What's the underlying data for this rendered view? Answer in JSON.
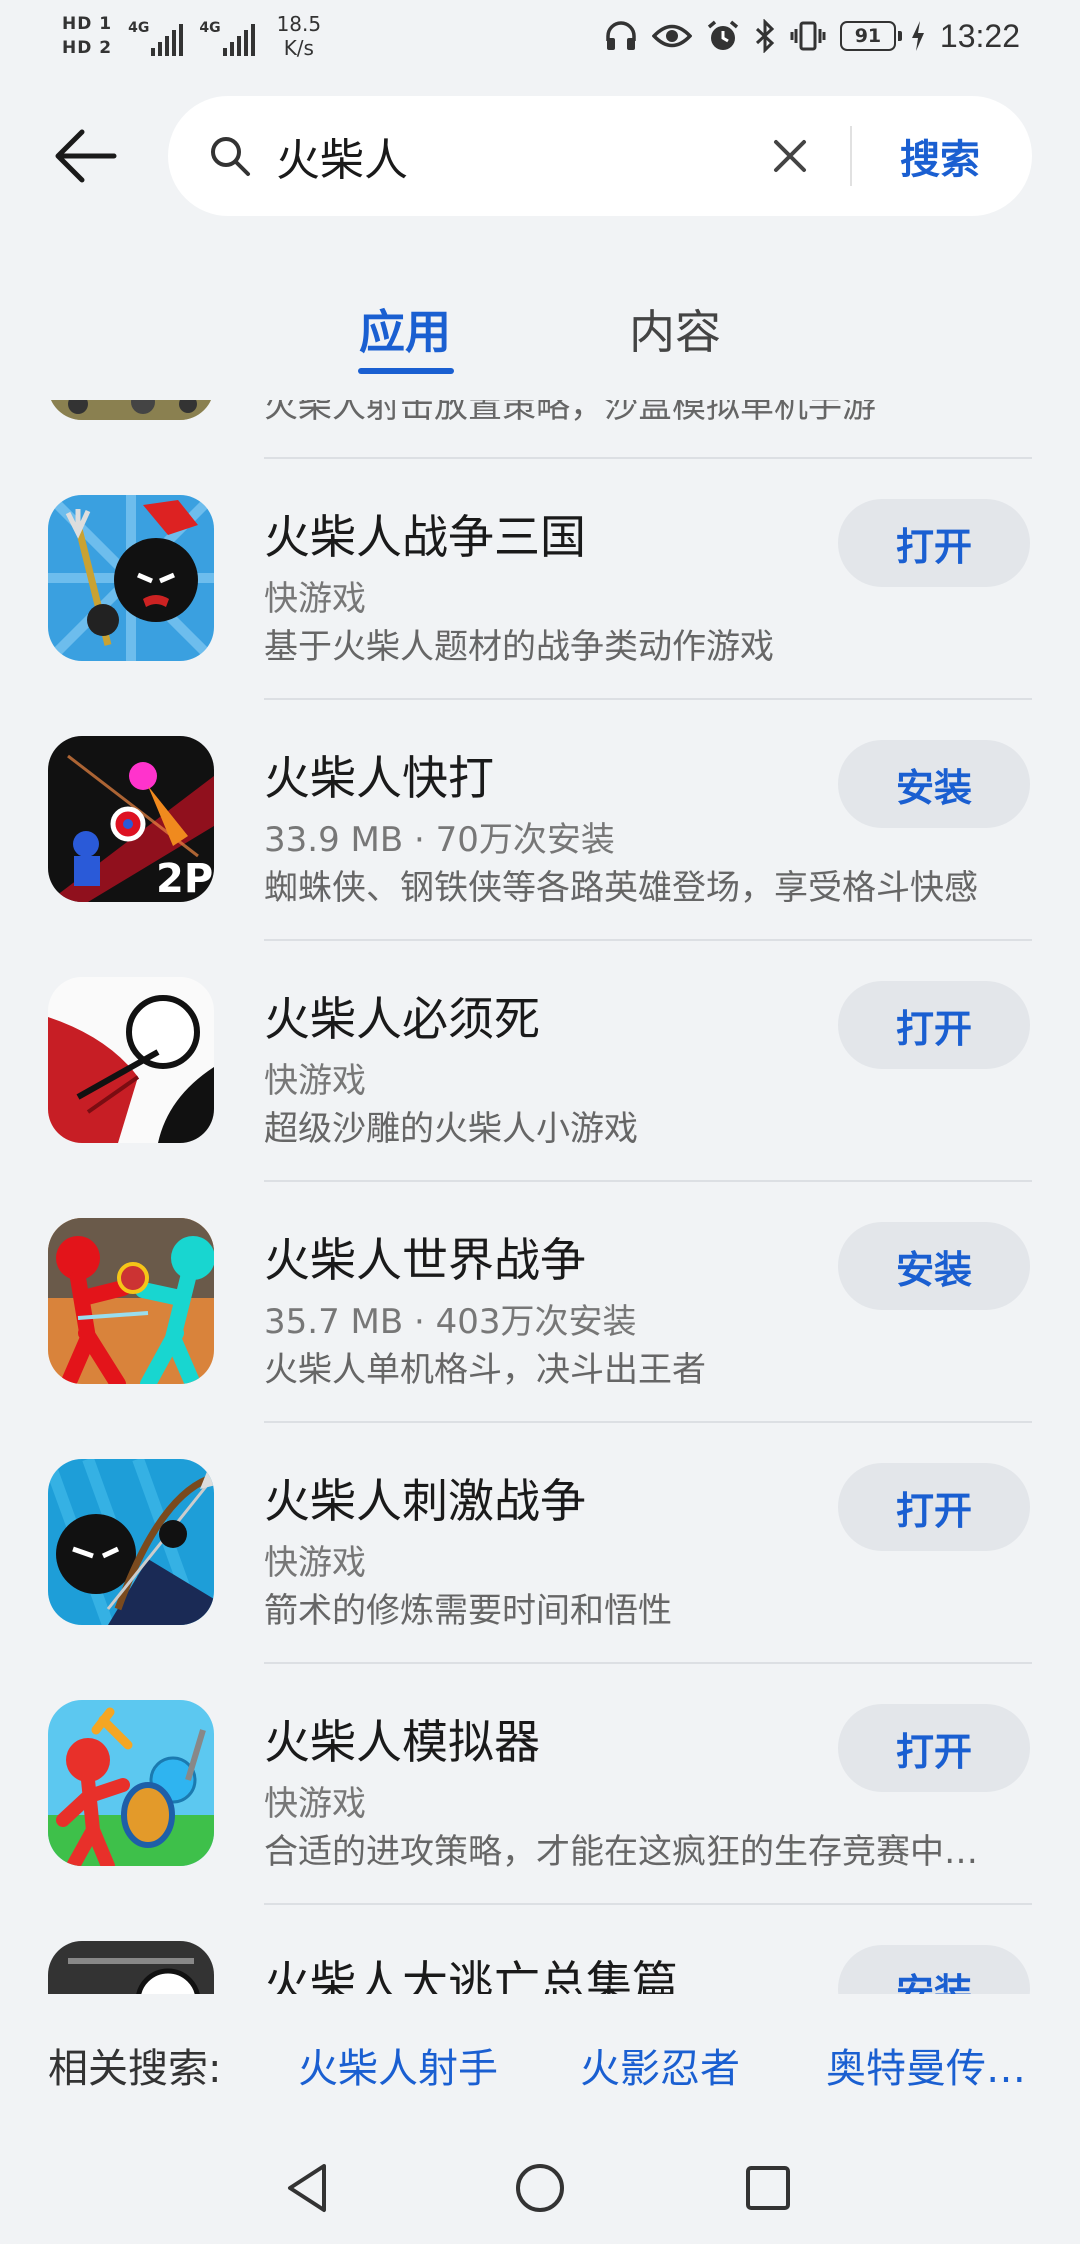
{
  "status_bar": {
    "sim1": "HD 1",
    "sim2": "HD 2",
    "net1": "4G",
    "net2": "4G",
    "speed_value": "18.5",
    "speed_unit": "K/s",
    "battery": "91",
    "time": "13:22"
  },
  "search": {
    "query": "火柴人",
    "button_label": "搜索"
  },
  "tabs": [
    {
      "label": "应用",
      "active": true
    },
    {
      "label": "内容",
      "active": false
    }
  ],
  "apps": [
    {
      "name": "",
      "meta": "",
      "desc": "火柴人射击放置策略，沙盒模拟单机手游",
      "action": ""
    },
    {
      "name": "火柴人战争三国",
      "meta": "快游戏",
      "desc": "基于火柴人题材的战争类动作游戏",
      "action": "打开"
    },
    {
      "name": "火柴人快打",
      "meta": "33.9 MB · 70万次安装",
      "desc": "蜘蛛侠、钢铁侠等各路英雄登场，享受格斗快感",
      "action": "安装"
    },
    {
      "name": "火柴人必须死",
      "meta": "快游戏",
      "desc": "超级沙雕的火柴人小游戏",
      "action": "打开"
    },
    {
      "name": "火柴人世界战争",
      "meta": "35.7 MB · 403万次安装",
      "desc": "火柴人单机格斗，决斗出王者",
      "action": "安装"
    },
    {
      "name": "火柴人刺激战争",
      "meta": "快游戏",
      "desc": "箭术的修炼需要时间和悟性",
      "action": "打开"
    },
    {
      "name": "火柴人模拟器",
      "meta": "快游戏",
      "desc": "合适的进攻策略，才能在这疯狂的生存竞赛中…",
      "action": "打开"
    },
    {
      "name": "火柴人大逃亡总集篇",
      "meta": "",
      "desc": "",
      "action": "安装"
    }
  ],
  "related": {
    "label": "相关搜索:",
    "items": [
      "火柴人射手",
      "火影忍者",
      "奥特曼传…"
    ]
  },
  "colors": {
    "accent": "#1a5fd1",
    "background": "#f1f3f5",
    "button_bg": "#e3e6ea"
  }
}
